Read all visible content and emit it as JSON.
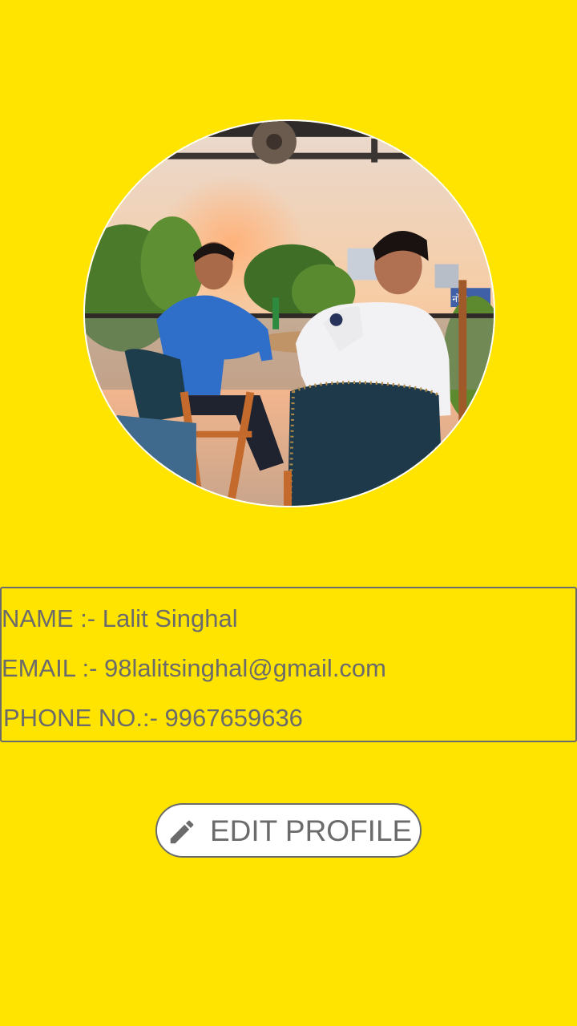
{
  "profile": {
    "name_line": "NAME :- Lalit Singhal",
    "email_line": "EMAIL :- 98lalitsinghal@gmail.com",
    "phone_line": "PHONE NO.:- 9967659636"
  },
  "edit_button": {
    "label": "EDIT PROFILE",
    "icon": "pencil-icon"
  },
  "photo": {
    "sign_text": "नोज"
  },
  "colors": {
    "background": "#FFE400",
    "text": "#6b6b6b",
    "button_background": "#ffffff"
  }
}
